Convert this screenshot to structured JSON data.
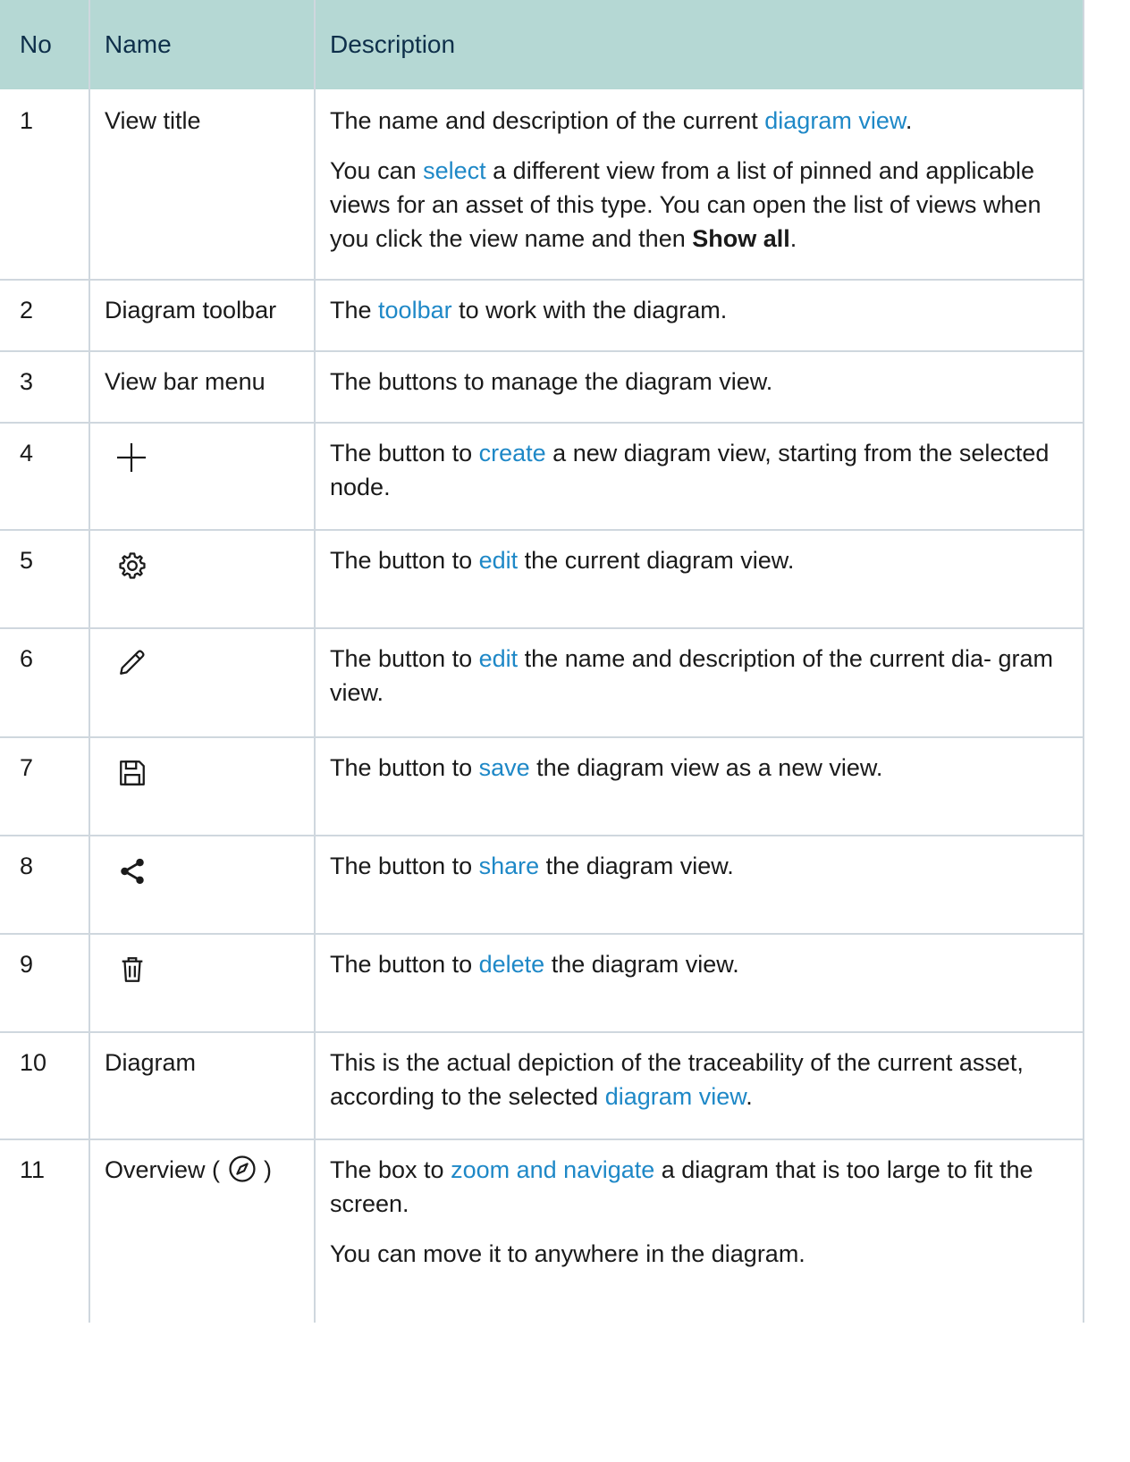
{
  "header": {
    "no": "No",
    "name": "Name",
    "description": "Description"
  },
  "rows": [
    {
      "no": "1",
      "name": "View title",
      "p1_before": "The name and description of the current ",
      "p1_link": "diagram view",
      "p1_after": ".",
      "p2_before": "You can ",
      "p2_link": "select",
      "p2_after": " a different view from a list of pinned and applicable views for an asset of this type. You can open the list of views when you click the view name and then ",
      "p2_bold": "Show all",
      "p2_end": "."
    },
    {
      "no": "2",
      "name": "Diagram toolbar",
      "before": "The ",
      "link": "toolbar",
      "after": " to work with the diagram."
    },
    {
      "no": "3",
      "name": "View bar menu",
      "text": "The buttons to manage the diagram view."
    },
    {
      "no": "4",
      "icon": "plus-icon",
      "before": "The button to ",
      "link": "create",
      "after": " a new diagram view, starting from the selected node."
    },
    {
      "no": "5",
      "icon": "gear-icon",
      "before": "The button to ",
      "link": "edit",
      "after": " the current diagram view."
    },
    {
      "no": "6",
      "icon": "pencil-icon",
      "before": "The button to ",
      "link": "edit",
      "after": " the name and description of the current dia- gram view."
    },
    {
      "no": "7",
      "icon": "save-icon",
      "before": "The button to ",
      "link": "save",
      "after": " the diagram view as a new view."
    },
    {
      "no": "8",
      "icon": "share-icon",
      "before": "The button to ",
      "link": "share",
      "after": " the diagram view."
    },
    {
      "no": "9",
      "icon": "trash-icon",
      "before": "The button to ",
      "link": "delete",
      "after": " the diagram view."
    },
    {
      "no": "10",
      "name": "Diagram",
      "before": "This is the actual depiction of the traceability of the current asset, according to the selected ",
      "link": "diagram view",
      "after": "."
    },
    {
      "no": "11",
      "name_before": "Overview (",
      "name_icon": "compass-icon",
      "name_after": ")",
      "p1_before": "The box to ",
      "p1_link": "zoom and navigate",
      "p1_after": " a diagram that is too large to fit the screen.",
      "p2": "You can move it to anywhere in the diagram."
    }
  ],
  "colors": {
    "header_bg": "#b5d8d4",
    "link": "#1e88c7",
    "border": "#cfd7de"
  }
}
